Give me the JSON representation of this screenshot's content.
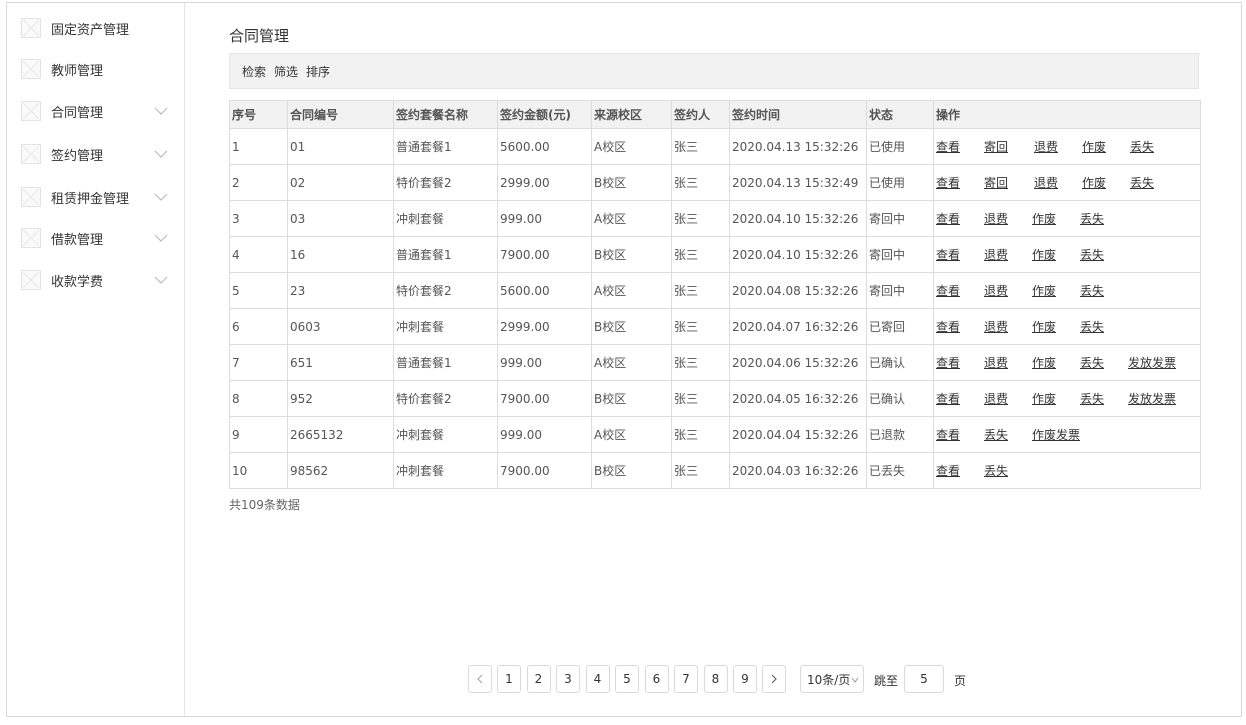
{
  "sidebar": {
    "items": [
      {
        "label": "固定资产管理",
        "icon": "broken-image-icon",
        "has_chevron": false
      },
      {
        "label": "教师管理",
        "icon": "broken-image-icon",
        "has_chevron": false
      },
      {
        "label": "合同管理",
        "icon": "broken-image-icon",
        "has_chevron": true
      },
      {
        "label": "签约管理",
        "icon": "broken-image-icon",
        "has_chevron": true
      },
      {
        "label": "租赁押金管理",
        "icon": "broken-image-icon",
        "has_chevron": true
      },
      {
        "label": "借款管理",
        "icon": "broken-image-icon",
        "has_chevron": true
      },
      {
        "label": "收款学费",
        "icon": "broken-image-icon",
        "has_chevron": true
      }
    ]
  },
  "main": {
    "title": "合同管理",
    "toolbar": {
      "search": "检索",
      "filter": "筛选",
      "sort": "排序"
    },
    "table": {
      "headers": [
        "序号",
        "合同编号",
        "签约套餐名称",
        "签约金额(元)",
        "来源校区",
        "签约人",
        "签约时间",
        "状态",
        "操作"
      ],
      "rows": [
        {
          "cells": [
            "1",
            "01",
            "普通套餐1",
            "5600.00",
            "A校区",
            "张三",
            "2020.04.13 15:32:26",
            "已使用"
          ],
          "ops": [
            "查看",
            "寄回",
            "退费",
            "作废",
            "丢失"
          ]
        },
        {
          "cells": [
            "2",
            "02",
            "特价套餐2",
            "2999.00",
            "B校区",
            "张三",
            "2020.04.13 15:32:49",
            "已使用"
          ],
          "ops": [
            "查看",
            "寄回",
            "退费",
            "作废",
            "丢失"
          ]
        },
        {
          "cells": [
            "3",
            "03",
            "冲刺套餐",
            "999.00",
            "A校区",
            "张三",
            "2020.04.10 15:32:26",
            "寄回中"
          ],
          "ops": [
            "查看",
            "退费",
            "作废",
            "丢失"
          ]
        },
        {
          "cells": [
            "4",
            "16",
            "普通套餐1",
            "7900.00",
            "B校区",
            "张三",
            "2020.04.10 15:32:26",
            "寄回中"
          ],
          "ops": [
            "查看",
            "退费",
            "作废",
            "丢失"
          ]
        },
        {
          "cells": [
            "5",
            "23",
            "特价套餐2",
            "5600.00",
            "A校区",
            "张三",
            "2020.04.08 15:32:26",
            "寄回中"
          ],
          "ops": [
            "查看",
            "退费",
            "作废",
            "丢失"
          ]
        },
        {
          "cells": [
            "6",
            "0603",
            "冲刺套餐",
            "2999.00",
            "B校区",
            "张三",
            "2020.04.07 16:32:26",
            "已寄回"
          ],
          "ops": [
            "查看",
            "退费",
            "作废",
            "丢失"
          ]
        },
        {
          "cells": [
            "7",
            "651",
            "普通套餐1",
            "999.00",
            "A校区",
            "张三",
            "2020.04.06 15:32:26",
            "已确认"
          ],
          "ops": [
            "查看",
            "退费",
            "作废",
            "丢失",
            "发放发票"
          ]
        },
        {
          "cells": [
            "8",
            "952",
            "特价套餐2",
            "7900.00",
            "B校区",
            "张三",
            "2020.04.05 16:32:26",
            "已确认"
          ],
          "ops": [
            "查看",
            "退费",
            "作废",
            "丢失",
            "发放发票"
          ]
        },
        {
          "cells": [
            "9",
            "2665132",
            "冲刺套餐",
            "999.00",
            "A校区",
            "张三",
            "2020.04.04 15:32:26",
            "已退款"
          ],
          "ops": [
            "查看",
            "丢失",
            "作废发票"
          ]
        },
        {
          "cells": [
            "10",
            "98562",
            "冲刺套餐",
            "7900.00",
            "B校区",
            "张三",
            "2020.04.03 16:32:26",
            "已丢失"
          ],
          "ops": [
            "查看",
            "丢失"
          ]
        }
      ]
    },
    "total_text": "共109条数据"
  },
  "pagination": {
    "pages": [
      "1",
      "2",
      "3",
      "4",
      "5",
      "6",
      "7",
      "8",
      "9"
    ],
    "page_size": "10条/页",
    "jump_label": "跳至",
    "jump_value": "5",
    "jump_suffix": "页"
  }
}
